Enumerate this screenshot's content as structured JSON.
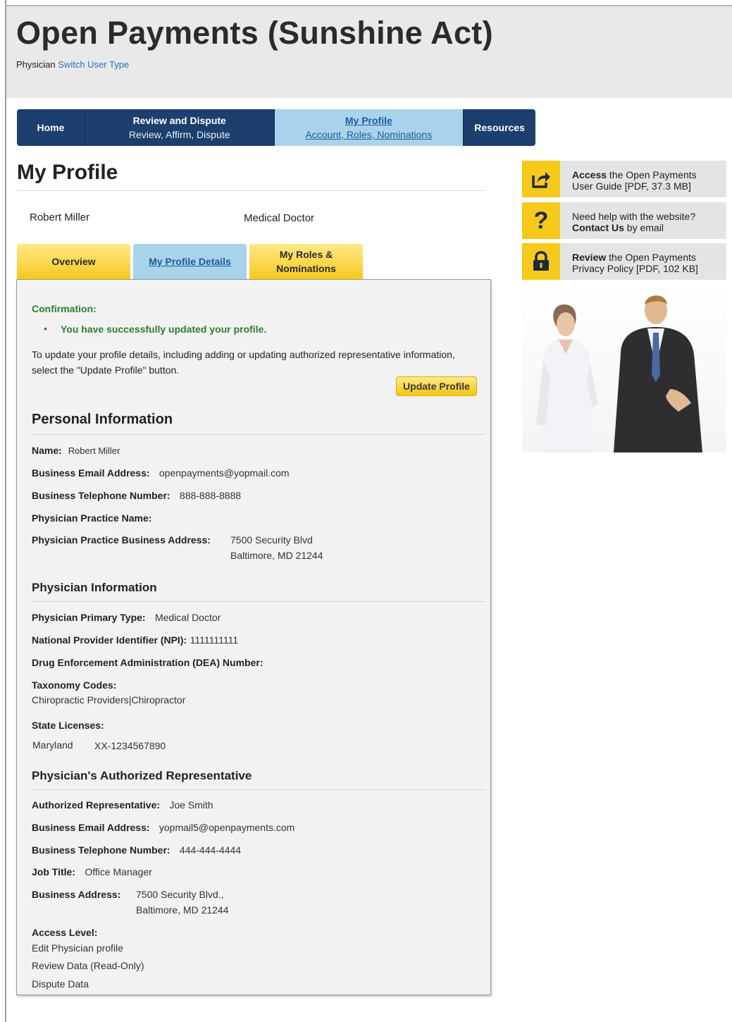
{
  "header": {
    "title": "Open Payments (Sunshine Act)",
    "user_type": "Physician",
    "switch_link": "Switch User Type"
  },
  "nav": {
    "home": "Home",
    "review_title": "Review and Dispute",
    "review_sub": "Review, Affirm, Dispute",
    "profile_title": "My Profile",
    "profile_sub": "Account, Roles, Nominations",
    "resources": "Resources"
  },
  "page": {
    "title": "My Profile",
    "user_name": "Robert Miller",
    "user_type": "Medical Doctor"
  },
  "tabs": {
    "overview": "Overview",
    "details": "My Profile Details",
    "roles_line1": "My Roles &",
    "roles_line2": "Nominations"
  },
  "confirmation": {
    "label": "Confirmation:",
    "bullet": "•",
    "message": "You have successfully updated your profile.",
    "instructions": "To update your profile details, including adding or updating authorized representative information, select the \"Update Profile\" button.",
    "button": "Update Profile"
  },
  "personal": {
    "title": "Personal Information",
    "name_label": "Name:",
    "name_value": "Robert Miller",
    "email_label": "Business Email Address:",
    "email_value": "openpayments@yopmail.com",
    "phone_label": "Business Telephone Number:",
    "phone_value": "888-888-8888",
    "practice_name_label": "Physician Practice Name:",
    "practice_addr_label": "Physician Practice Business Address:",
    "practice_addr_line1": "7500 Security Blvd",
    "practice_addr_line2": "Baltimore, MD 21244"
  },
  "physician": {
    "title": "Physician Information",
    "primary_type_label": "Physician Primary Type:",
    "primary_type_value": "Medical Doctor",
    "npi_label": "National Provider Identifier (NPI):",
    "npi_value": "1111111111",
    "dea_label": "Drug Enforcement Administration (DEA) Number:",
    "taxonomy_label": "Taxonomy Codes:",
    "taxonomy_value": "Chiropractic Providers|Chiropractor",
    "licenses_label": "State Licenses:",
    "license_state": "Maryland",
    "license_number": "XX-1234567890"
  },
  "representative": {
    "title": "Physician's Authorized Representative",
    "rep_label": "Authorized Representative:",
    "rep_value": "Joe Smith",
    "email_label": "Business Email Address:",
    "email_value": "yopmail5@openpayments.com",
    "phone_label": "Business Telephone Number:",
    "phone_value": "444-444-4444",
    "job_label": "Job Title:",
    "job_value": "Office Manager",
    "address_label": "Business Address:",
    "address_line1": "7500 Security Blvd.,",
    "address_line2": "Baltimore, MD 21244",
    "access_label": "Access Level:",
    "access_items": [
      "Edit Physician profile",
      "Review Data (Read-Only)",
      "Dispute Data"
    ]
  },
  "sidebar": {
    "guide_bold": "Access",
    "guide_rest": " the Open Payments",
    "guide_line2": "User Guide [PDF, 37.3 MB]",
    "help_line1": "Need help with the website?",
    "help_bold": "Contact Us",
    "help_rest": " by email",
    "privacy_bold": "Review",
    "privacy_rest": " the Open Payments",
    "privacy_line2": "Privacy Policy [PDF, 102 KB]"
  },
  "colors": {
    "nav_blue": "#1c3f6e",
    "active_tab": "#a8d3eb",
    "tab_yellow": "#f6c91b",
    "confirm_green": "#2e7d32",
    "link_blue": "#2a6fbf"
  },
  "icons": {
    "guide": "share-arrow-icon",
    "help": "question-mark-icon",
    "privacy": "lock-icon"
  }
}
